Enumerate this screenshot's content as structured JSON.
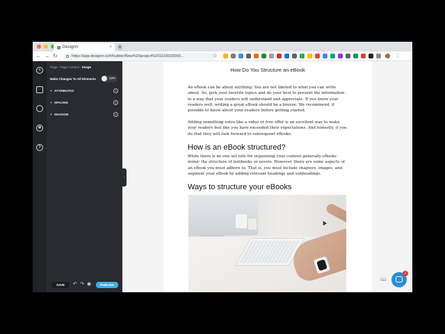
{
  "browser": {
    "tab_title": "Designrr",
    "url": "https://app.designrr.io/#/builder/New%20project%201016020000..."
  },
  "colors": {
    "panel_bg": "#2a2b30",
    "rail_bg": "#222327",
    "publish": "#3bb0e6",
    "chat": "#2b8fd6"
  },
  "rail": {
    "icons": [
      "plus-icon",
      "layers-icon",
      "history-icon",
      "settings-icon",
      "help-icon",
      "exit-icon"
    ]
  },
  "panel": {
    "breadcrumb": {
      "a": "Page",
      "sep1": " › ",
      "b": "Page Content",
      "sep2": " › ",
      "c": "Image"
    },
    "make_changes_label": "Make Changes To All Elements",
    "toggle_label": "OFF",
    "sections": [
      {
        "label": "ATTRIBUTES",
        "help": "?"
      },
      {
        "label": "SPACING",
        "help": "?"
      },
      {
        "label": "SHADOW",
        "help": "?"
      }
    ],
    "save_label": "SAVE",
    "publish_label": "PUBLISH"
  },
  "document": {
    "title": "How Do You Structure an eBook",
    "para1": "An eBook can be about anything. You are not limited to what you can write about. So, pick your favorite topics and do your best to present the information in a way that your readers will understand and appreciate. If you know your readers well, writing a great eBook should be a breeze. We recommend, if possible to know about your readers before getting started.",
    "para2": "Adding something extra like a video or free offer is an excellent way to make your readers feel like you have exceeded their expectations. And honestly, if you do that they will look forward to subsequent eBooks.",
    "heading1": "How is an eBook structured?",
    "para3": "While there is no one set rule for organizing your content generally eBooks mimic the structure of textbooks or novels. However, there are some aspects of an eBook you must adhere to. That is, you must include chapters, images, and segment your eBook by adding relevant headings and subheadings.",
    "heading2": "Ways to structure your eBooks"
  },
  "chat_badge": "1"
}
